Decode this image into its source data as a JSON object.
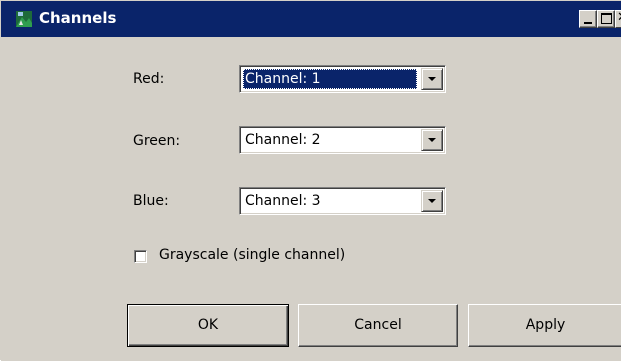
{
  "window": {
    "title": "Channels",
    "icon": "channels-app-icon",
    "controls": {
      "minimize_icon": "minimize-icon",
      "maximize_icon": "maximize-icon",
      "close_icon": "close-icon"
    }
  },
  "fields": {
    "red": {
      "label": "Red:",
      "value": "Channel: 1",
      "selected": true
    },
    "green": {
      "label": "Green:",
      "value": "Channel: 2"
    },
    "blue": {
      "label": "Blue:",
      "value": "Channel: 3"
    }
  },
  "grayscale": {
    "label": "Grayscale (single channel)",
    "checked": false
  },
  "buttons": {
    "ok": "OK",
    "cancel": "Cancel",
    "apply": "Apply"
  },
  "colors": {
    "titlebar": "#0a246a",
    "face": "#d4d0c8",
    "selection": "#0a246a"
  }
}
